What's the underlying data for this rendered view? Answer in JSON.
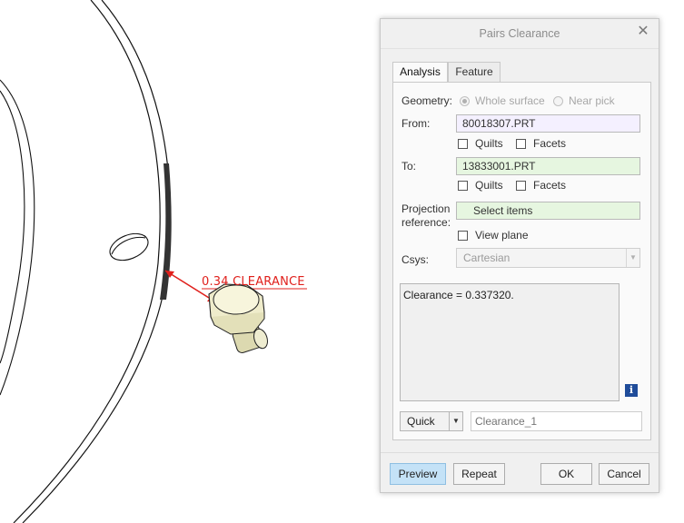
{
  "viewport": {
    "annotation_label": "0.34 CLEARANCE",
    "colors": {
      "annotation": "#e0201c",
      "model_lines": "#111111"
    }
  },
  "dialog": {
    "title": "Pairs Clearance",
    "close_icon": "close-icon",
    "tabs": [
      {
        "label": "Analysis",
        "active": true
      },
      {
        "label": "Feature",
        "active": false
      }
    ],
    "geometry": {
      "label": "Geometry:",
      "options": [
        {
          "label": "Whole surface",
          "selected": true,
          "enabled": false
        },
        {
          "label": "Near pick",
          "selected": false,
          "enabled": false
        }
      ]
    },
    "from": {
      "label": "From:",
      "value": "80018307.PRT",
      "quilts_label": "Quilts",
      "facets_label": "Facets"
    },
    "to": {
      "label": "To:",
      "value": "13833001.PRT",
      "quilts_label": "Quilts",
      "facets_label": "Facets"
    },
    "projection": {
      "label_line1": "Projection",
      "label_line2": "reference:",
      "value": "Select items",
      "view_plane_label": "View plane"
    },
    "csys": {
      "label": "Csys:",
      "value": "Cartesian"
    },
    "results_text": "Clearance = 0.337320.",
    "quick_label": "Quick",
    "name_placeholder": "Clearance_1",
    "buttons": {
      "preview": "Preview",
      "repeat": "Repeat",
      "ok": "OK",
      "cancel": "Cancel"
    },
    "colors": {
      "from_field": "#f4f0ff",
      "to_field": "#e6f6e0",
      "preview_button": "#c4e2f7",
      "info_icon": "#1f4c9a"
    }
  }
}
